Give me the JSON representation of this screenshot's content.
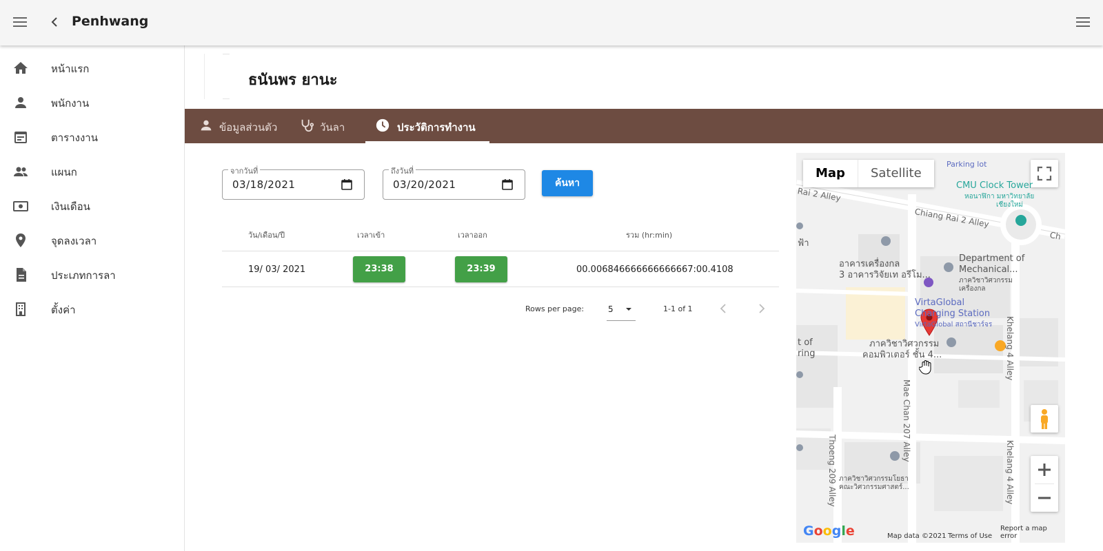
{
  "appbar": {
    "title": "Penhwang"
  },
  "sidebar": {
    "items": [
      {
        "label": "หน้าแรก",
        "icon": "home-icon"
      },
      {
        "label": "พนักงาน",
        "icon": "person-icon"
      },
      {
        "label": "ตารางงาน",
        "icon": "calendar-icon"
      },
      {
        "label": "แผนก",
        "icon": "people-icon"
      },
      {
        "label": "เงินเดือน",
        "icon": "money-icon"
      },
      {
        "label": "จุดลงเวลา",
        "icon": "location-pin-icon"
      },
      {
        "label": "ประเภทการลา",
        "icon": "document-icon"
      },
      {
        "label": "ตั้งค่า",
        "icon": "building-settings-icon"
      }
    ]
  },
  "employee": {
    "name": "ธนันพร ยานะ"
  },
  "tabs": [
    {
      "label": "ข้อมูลส่วนตัว",
      "icon": "person-icon",
      "active": false
    },
    {
      "label": "วันลา",
      "icon": "stethoscope-icon",
      "active": false
    },
    {
      "label": "ประวัติการทำงาน",
      "icon": "clock-icon",
      "active": true
    }
  ],
  "filters": {
    "from": {
      "label": "จากวันที่",
      "value": "03/18/2021"
    },
    "to": {
      "label": "ถึงวันที่",
      "value": "03/20/2021"
    },
    "search_label": "ค้นหา"
  },
  "table": {
    "headers": [
      "วัน/เดือน/ปี",
      "เวลาเข้า",
      "เวลาออก",
      "รวม (hr:min)"
    ],
    "rows": [
      {
        "date": "19/ 03/ 2021",
        "in": "23:38",
        "out": "23:39",
        "total": "00.006846666666666667:00.4108"
      }
    ]
  },
  "pagination": {
    "rows_per_page_label": "Rows per page:",
    "rows_per_page": "5",
    "range": "1-1 of 1"
  },
  "map": {
    "type_map": "Map",
    "type_satellite": "Satellite",
    "labels": {
      "parking": "Parking lot",
      "clock_tower": "CMU Clock Tower",
      "clock_tower_th": "หอนาฬิกา มหาวิทยาลัย",
      "clock_tower_th2": "เชียงใหม่",
      "chiang_rai_2_alley_a": "Chiang Rai 2 Alley",
      "rai_2_alley": "Rai 2 Alley",
      "ch": "Ch",
      "dept_mech": "Department of",
      "dept_mech2": "Mechanical...",
      "dept_mech_th": "ภาควิชาวิศวกรรม",
      "dept_mech_th2": "เครื่องกล",
      "bldg_th": "อาคารเครื่องกล",
      "bldg_th2": "3 อาคารวิจัยเท อรีโม...",
      "fa": "ฟ้า",
      "virta": "VirtaGlobal",
      "virta2": "Charging Station",
      "virta_th": "VirtaGlobal สถานีชาร์จร",
      "comp_th": "ภาควิชาวิศวกรรม",
      "comp_th2": "คอมพิวเตอร์ ชั้น 4...",
      "t_of": "t of",
      "ring": "ring",
      "thoeng": "Thoeng 209 Alley",
      "mae_chan": "Mae Chan 207 Alley",
      "khelang_a": "Khelang 4 Alley",
      "khelang_b": "Khelang 4 Alley",
      "bottom_th": "ภาควิชาวิศวกรรมโยธา",
      "bottom_th2": "คณะวิศวกรรมศาสตร์..."
    },
    "google": "Google",
    "footer": [
      "Map data ©2021",
      "Terms of Use",
      "Report a map error"
    ],
    "pin_color": "#e53935"
  },
  "colors": {
    "tabbar": "#6d4c41",
    "chip": "#43a047",
    "search": "#1e88e5"
  }
}
